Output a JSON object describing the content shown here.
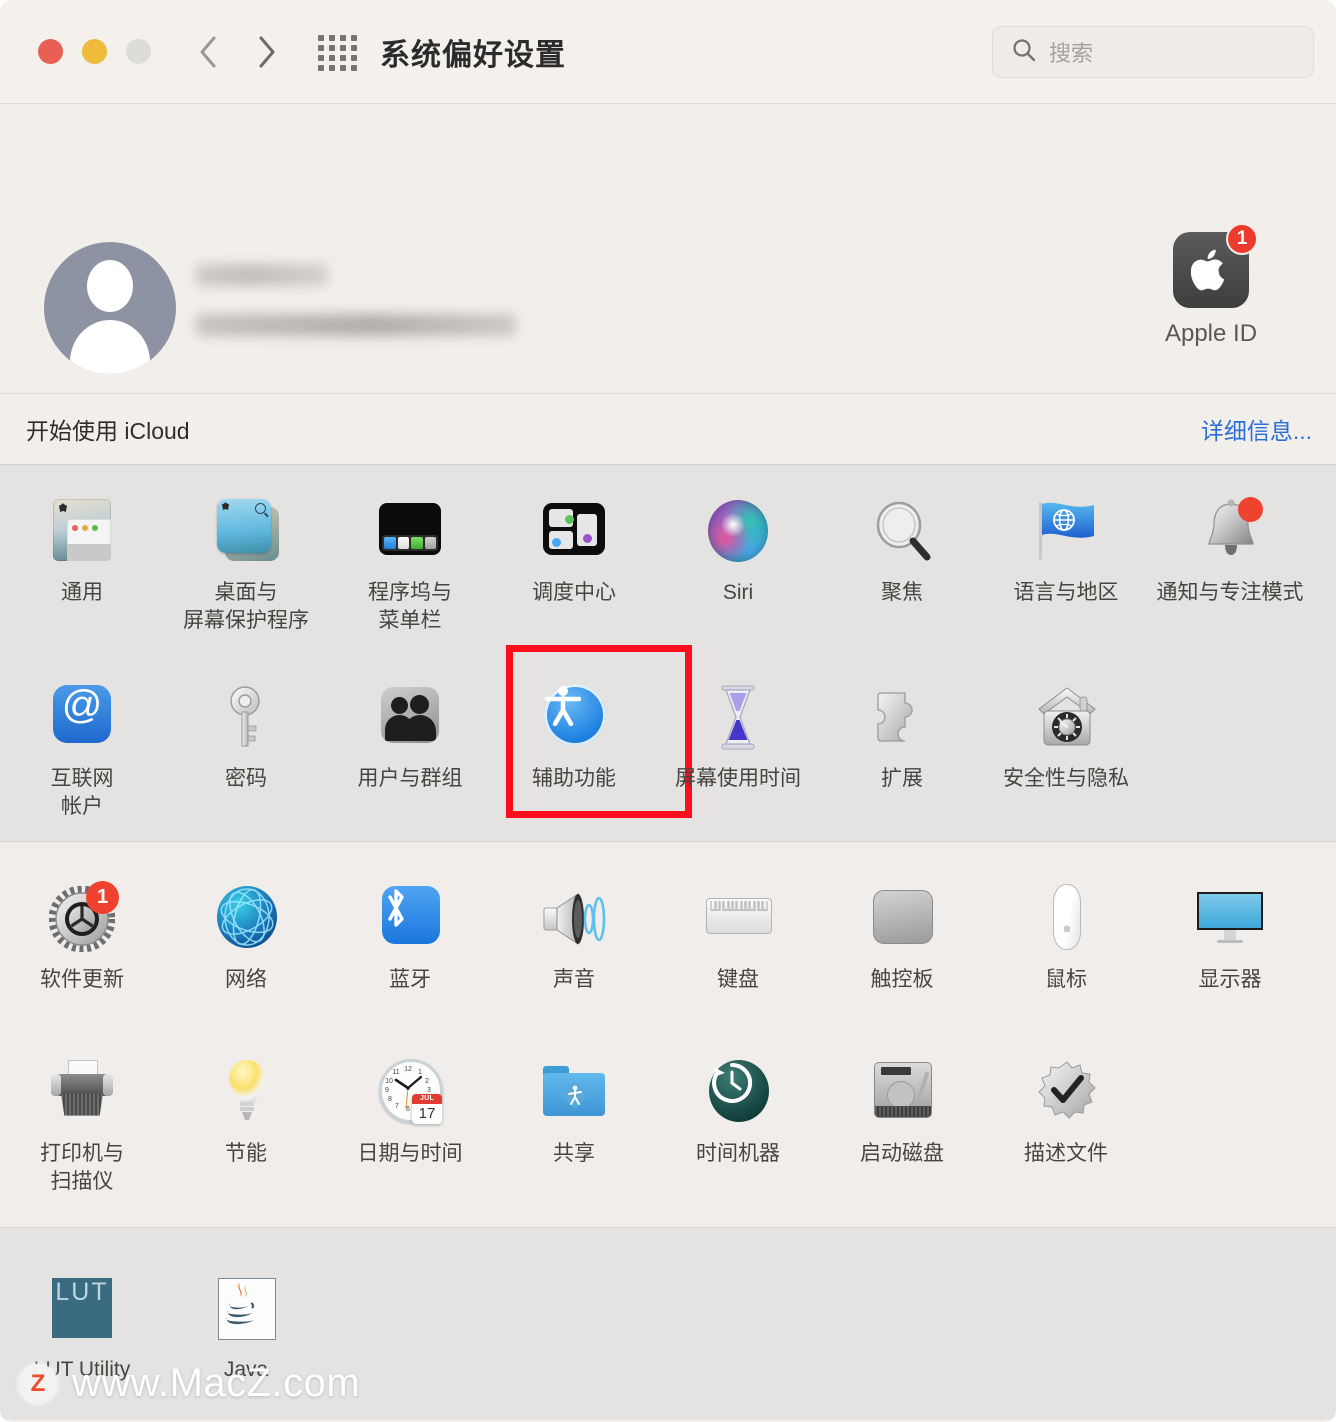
{
  "titlebar": {
    "title": "系统偏好设置",
    "back_label": "‹",
    "forward_label": "›",
    "grid_label": "全部显示",
    "search_placeholder": "搜索",
    "search_value": ""
  },
  "banner": {
    "apple_id_label": "Apple ID",
    "apple_id_badge": "1",
    "account_name_redacted": "",
    "account_email_redacted": ""
  },
  "icloud": {
    "text": "开始使用 iCloud",
    "more_link": "详细信息..."
  },
  "sections": [
    {
      "id": "section-personal",
      "background": "#e4e3e1",
      "rows": [
        [
          {
            "label": "通用",
            "icon": "general-icon"
          },
          {
            "label": "桌面与\n屏幕保护程序",
            "icon": "desktop-screensaver-icon"
          },
          {
            "label": "程序坞与\n菜单栏",
            "icon": "dock-menubar-icon"
          },
          {
            "label": "调度中心",
            "icon": "mission-control-icon"
          },
          {
            "label": "Siri",
            "icon": "siri-icon"
          },
          {
            "label": "聚焦",
            "icon": "spotlight-icon"
          },
          {
            "label": "语言与地区",
            "icon": "language-region-icon"
          },
          {
            "label": "通知与专注模式",
            "icon": "notifications-icon",
            "badge": true
          }
        ],
        [
          {
            "label": "互联网\n帐户",
            "icon": "internet-accounts-icon"
          },
          {
            "label": "密码",
            "icon": "passwords-key-icon"
          },
          {
            "label": "用户与群组",
            "icon": "users-groups-icon"
          },
          {
            "label": "辅助功能",
            "icon": "accessibility-icon",
            "highlighted": true
          },
          {
            "label": "屏幕使用时间",
            "icon": "screen-time-icon"
          },
          {
            "label": "扩展",
            "icon": "extensions-puzzle-icon"
          },
          {
            "label": "安全性与隐私",
            "icon": "security-privacy-icon"
          }
        ]
      ]
    },
    {
      "id": "section-hardware",
      "background": "#f0edea",
      "rows": [
        [
          {
            "label": "软件更新",
            "icon": "software-update-icon",
            "badge": "1"
          },
          {
            "label": "网络",
            "icon": "network-globe-icon"
          },
          {
            "label": "蓝牙",
            "icon": "bluetooth-icon"
          },
          {
            "label": "声音",
            "icon": "sound-icon"
          },
          {
            "label": "键盘",
            "icon": "keyboard-icon"
          },
          {
            "label": "触控板",
            "icon": "trackpad-icon"
          },
          {
            "label": "鼠标",
            "icon": "mouse-icon"
          },
          {
            "label": "显示器",
            "icon": "displays-icon"
          }
        ],
        [
          {
            "label": "打印机与\n扫描仪",
            "icon": "printers-scanners-icon"
          },
          {
            "label": "节能",
            "icon": "energy-saver-icon"
          },
          {
            "label": "日期与时间",
            "icon": "date-time-icon",
            "clock_month": "JUL",
            "clock_day": "17"
          },
          {
            "label": "共享",
            "icon": "sharing-icon"
          },
          {
            "label": "时间机器",
            "icon": "time-machine-icon"
          },
          {
            "label": "启动磁盘",
            "icon": "startup-disk-icon"
          },
          {
            "label": "描述文件",
            "icon": "profiles-icon"
          }
        ]
      ]
    },
    {
      "id": "section-thirdparty",
      "background": "#e4e3e1",
      "rows": [
        [
          {
            "label": "LUT Utility",
            "icon": "lut-utility-icon",
            "icon_text": "LUT"
          },
          {
            "label": "Java",
            "icon": "java-icon"
          }
        ]
      ]
    }
  ],
  "watermark": {
    "logo_letter": "Z",
    "text": "www.MacZ.com"
  },
  "colors": {
    "accent_link": "#2a6fd6",
    "highlight_ring": "#fb0d1b",
    "badge_red": "#ef4330",
    "titlebar_bg": "#f4f1ed",
    "section_gray": "#e4e3e1",
    "section_light": "#f0edea"
  }
}
